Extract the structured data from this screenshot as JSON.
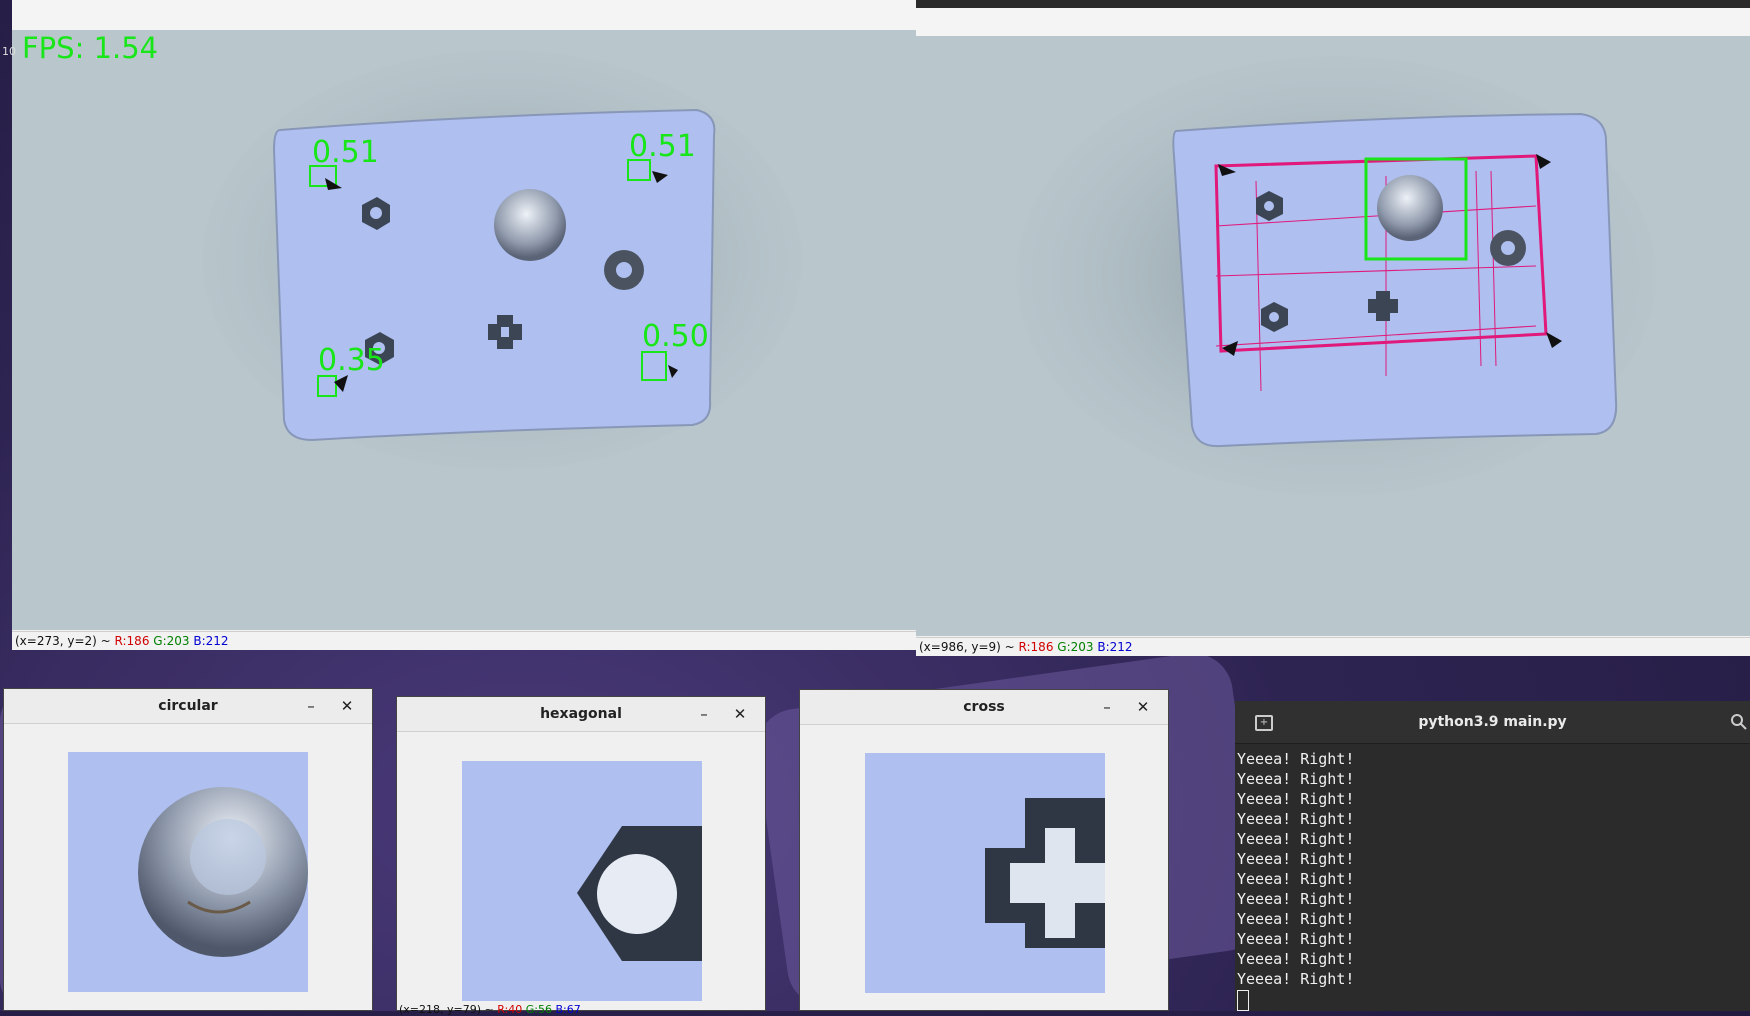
{
  "left_view": {
    "fps_label": "FPS:  1.54",
    "edge_text": "10",
    "scores": [
      "0.51",
      "0.51",
      "0.35",
      "0.50"
    ],
    "status": {
      "coords": "(x=273, y=2) ~ ",
      "r": "R:186",
      "g": "G:203",
      "b": "B:212"
    }
  },
  "right_view": {
    "status": {
      "coords": "(x=986, y=9) ~ ",
      "r": "R:186",
      "g": "G:203",
      "b": "B:212"
    },
    "overlay_color": "#e0197a",
    "box_color": "#19e619"
  },
  "windows": {
    "circular": {
      "title": "circular",
      "minimize": "–",
      "close": "✕"
    },
    "hexagonal": {
      "title": "hexagonal",
      "minimize": "–",
      "close": "✕",
      "status": {
        "coords": "(x=218, y=79) ~ ",
        "r": "R:40",
        "g": "G:56",
        "b": "B:67"
      }
    },
    "cross": {
      "title": "cross",
      "minimize": "–",
      "close": "✕"
    }
  },
  "terminal": {
    "title": "python3.9 main.py",
    "new_tab_icon": "new-tab-icon",
    "search_icon": "search-icon",
    "lines": [
      "Yeeea! Right!",
      "Yeeea! Right!",
      "Yeeea! Right!",
      "Yeeea! Right!",
      "Yeeea! Right!",
      "Yeeea! Right!",
      "Yeeea! Right!",
      "Yeeea! Right!",
      "Yeeea! Right!",
      "Yeeea! Right!",
      "Yeeea! Right!",
      "Yeeea! Right!"
    ]
  }
}
